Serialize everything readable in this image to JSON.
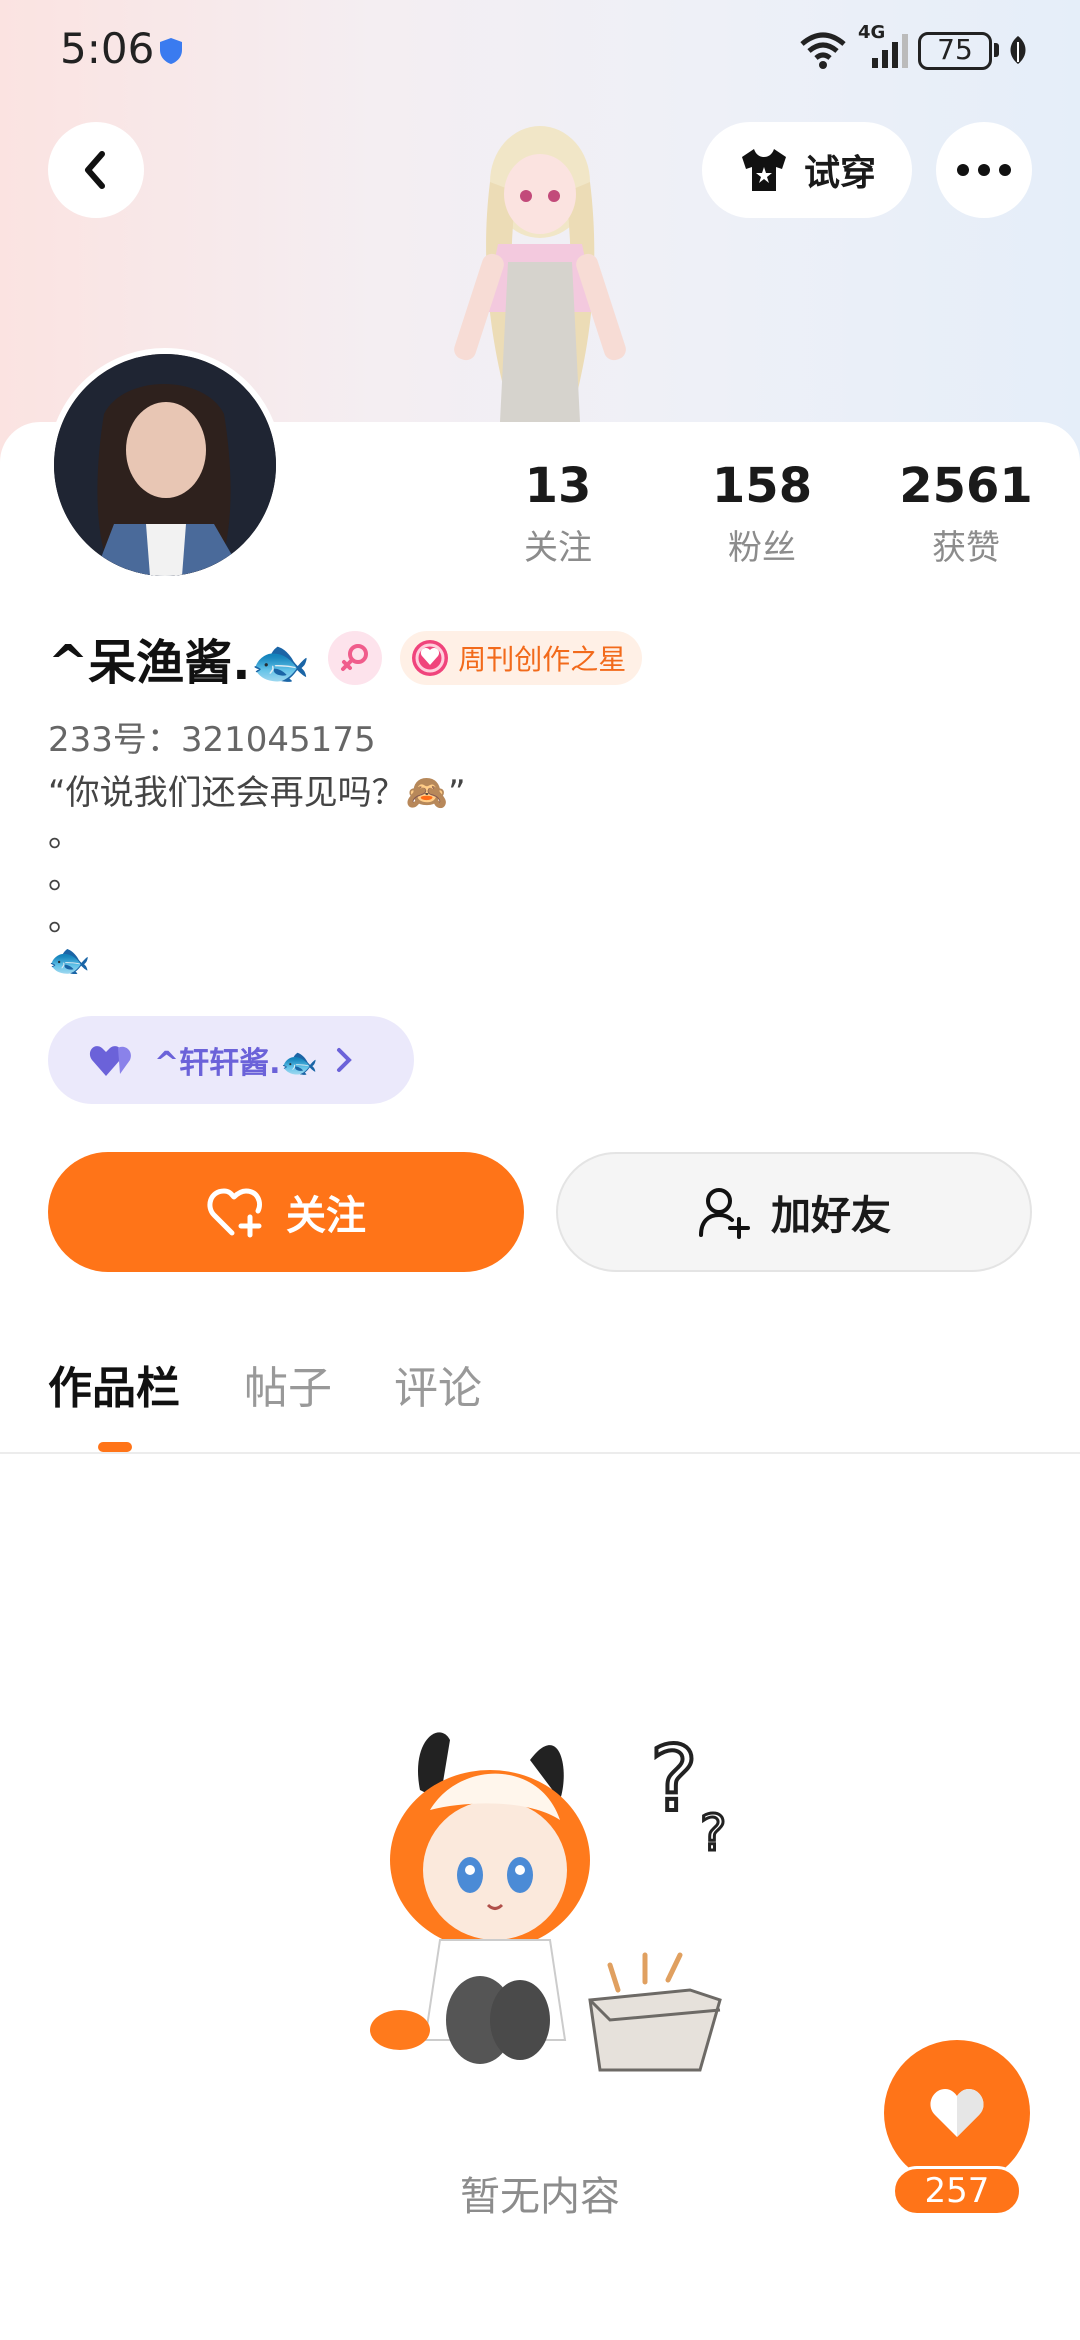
{
  "status_bar": {
    "time": "5:06",
    "network": "4G",
    "battery": "75"
  },
  "header": {
    "try_on_label": "试穿"
  },
  "profile": {
    "stats": [
      {
        "value": "13",
        "label": "关注"
      },
      {
        "value": "158",
        "label": "粉丝"
      },
      {
        "value": "2561",
        "label": "获赞"
      }
    ],
    "name": "^呆渔酱.🐟",
    "badge": "周刊创作之星",
    "uid": "233号：321045175",
    "bio": [
      "“你说我们还会再见吗？🙈”",
      "。",
      "。",
      "。",
      "🐟"
    ],
    "cp_name": "^轩轩酱.🐟"
  },
  "actions": {
    "follow": "关注",
    "add_friend": "加好友"
  },
  "tabs": [
    "作品栏",
    "帖子",
    "评论"
  ],
  "empty": {
    "text": "暂无内容"
  },
  "like_fab": {
    "count": "257"
  },
  "colors": {
    "accent": "#ff7418",
    "cp_purple": "#6b62d9"
  }
}
